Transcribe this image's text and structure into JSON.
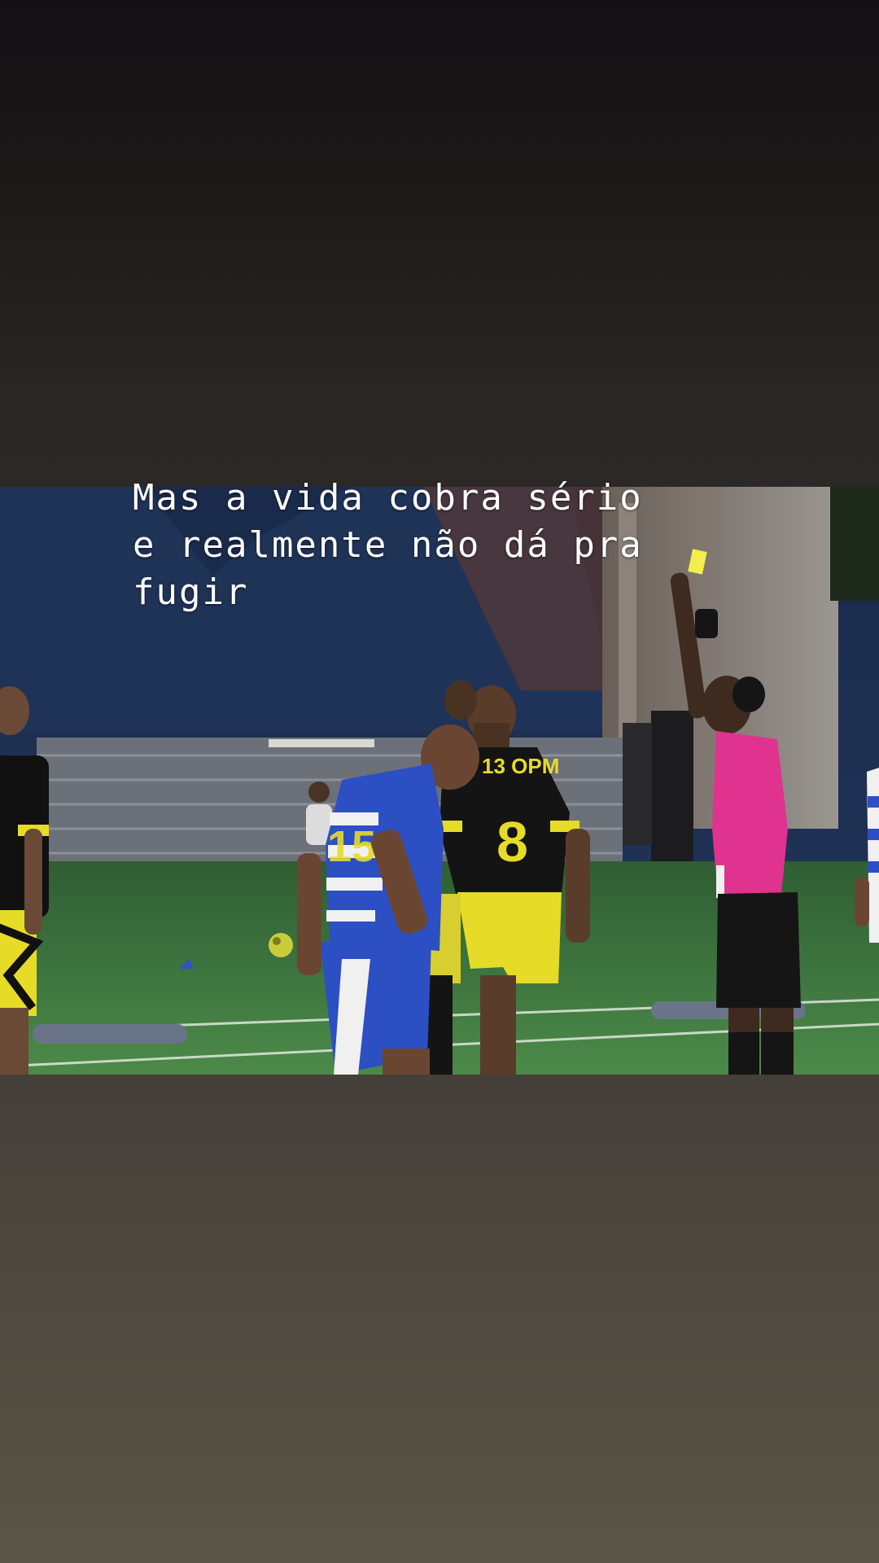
{
  "story": {
    "caption_text": "Mas a vida cobra sério\ne realmente não dá pra\nfugir"
  },
  "photo": {
    "scene": "soccer-match-yellow-card",
    "jersey_text": "13 OPM",
    "jersey_number": "8",
    "colors": {
      "top_background": "#141014",
      "bottom_background": "#5a5547",
      "field_green": "#3f7a3e",
      "referee_pink": "#e0338f",
      "team_yellow": "#e6dc28",
      "team_blue": "#2d4fc4"
    }
  }
}
